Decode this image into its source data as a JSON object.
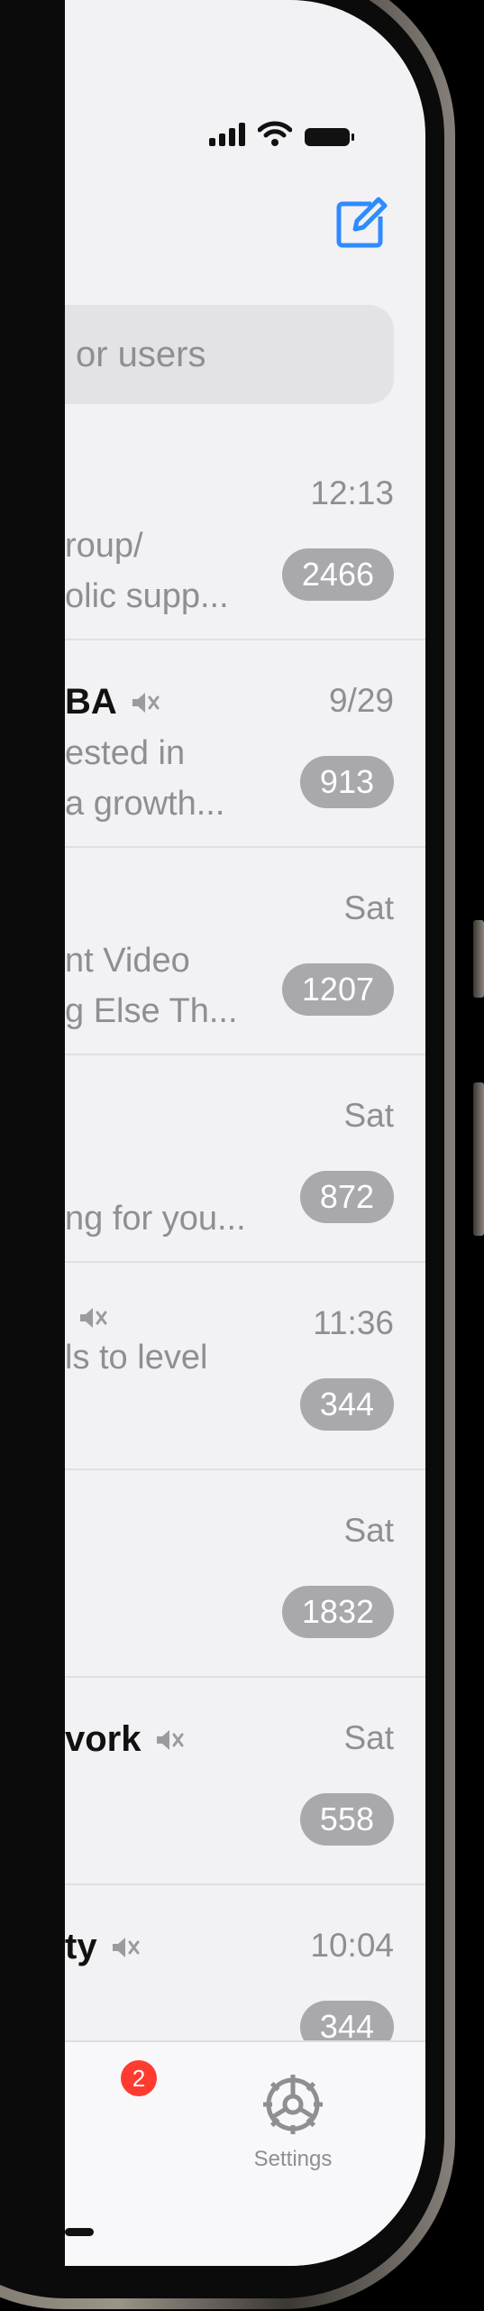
{
  "search": {
    "placeholder": "or users"
  },
  "chats": [
    {
      "name": "",
      "time": "12:13",
      "line1": "roup/",
      "line2": "olic supp...",
      "badge": "2466",
      "muted": false
    },
    {
      "name": "BA",
      "time": "9/29",
      "line1": "ested in",
      "line2": "a growth...",
      "badge": "913",
      "muted": true
    },
    {
      "name": "",
      "time": "Sat",
      "line1": "nt Video",
      "line2": "g Else Th...",
      "badge": "1207",
      "muted": false
    },
    {
      "name": "",
      "time": "Sat",
      "line1": "",
      "line2": "ng for you...",
      "badge": "872",
      "muted": false
    },
    {
      "name": "",
      "time": "11:36",
      "line1": "ls to level",
      "line2": "",
      "badge": "344",
      "muted": true
    },
    {
      "name": "",
      "time": "Sat",
      "line1": "",
      "line2": "",
      "badge": "1832",
      "muted": false
    },
    {
      "name": "vork",
      "time": "Sat",
      "line1": "",
      "line2": "",
      "badge": "558",
      "muted": true
    },
    {
      "name": "ty",
      "time": "10:04",
      "line1": "",
      "line2": "",
      "badge": "344",
      "muted": true
    }
  ],
  "tabbar": {
    "chats_badge": "2",
    "settings_label": "Settings"
  },
  "icons": {
    "compose": "compose-icon",
    "settings": "gear-icon",
    "mute": "mute-icon"
  },
  "colors": {
    "accent": "#2f8bff",
    "badge_muted": "#a8a8ad",
    "badge_alert": "#ff3b30"
  }
}
